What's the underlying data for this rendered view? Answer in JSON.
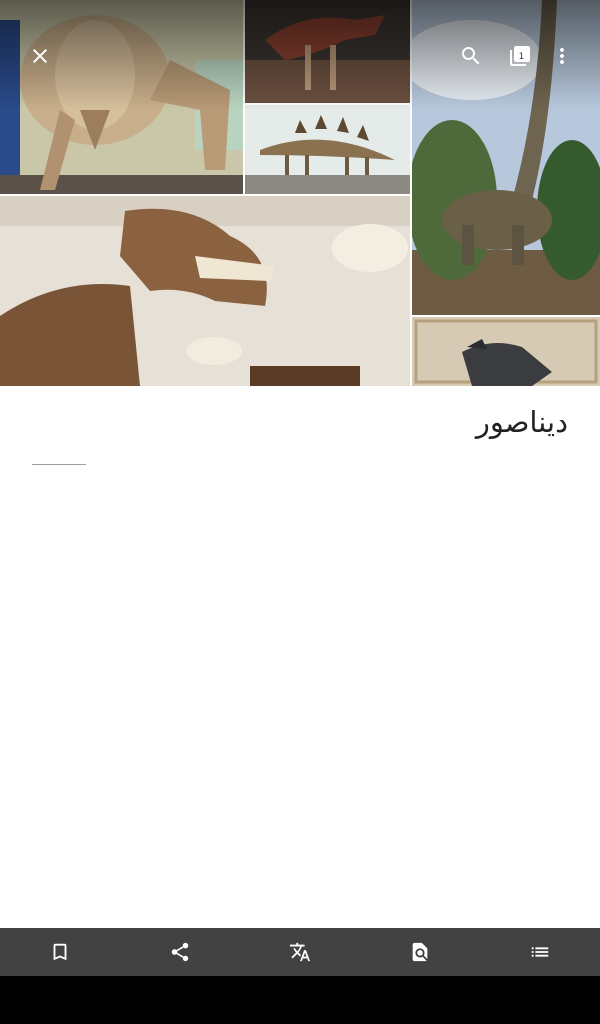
{
  "article": {
    "title": "دیناصور"
  },
  "toolbar": {
    "close_icon": "close-icon",
    "search_icon": "search-icon",
    "tabs_icon": "tabs-icon",
    "tabs_count": "1",
    "overflow_icon": "more-vert-icon"
  },
  "lead_images": [
    {
      "name": "triceratops-skeleton"
    },
    {
      "name": "theropod-skeleton"
    },
    {
      "name": "stegosaurus-skeleton"
    },
    {
      "name": "sauropod-statue"
    },
    {
      "name": "trex-skeleton"
    },
    {
      "name": "ceiling-skeleton"
    }
  ],
  "bottom_bar": [
    {
      "name": "save-button",
      "icon": "bookmark-icon"
    },
    {
      "name": "share-button",
      "icon": "share-icon"
    },
    {
      "name": "translate-button",
      "icon": "translate-icon"
    },
    {
      "name": "find-in-page-button",
      "icon": "find-in-page-icon"
    },
    {
      "name": "contents-button",
      "icon": "list-icon"
    }
  ],
  "colors": {
    "bottom_bar": "#424242",
    "nav_bar": "#000000",
    "title_text": "#222222"
  }
}
